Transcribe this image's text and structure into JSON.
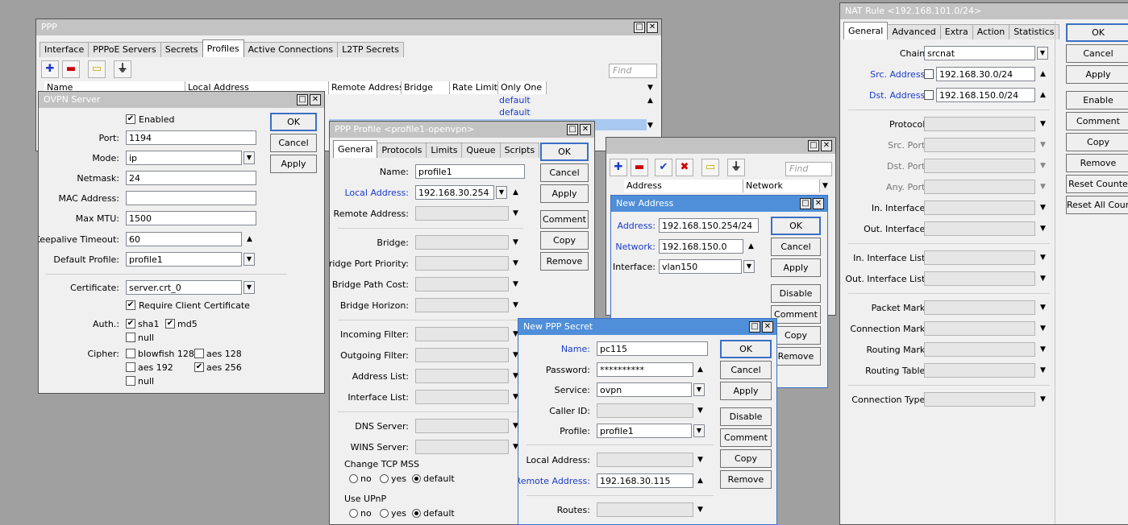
{
  "ppp": {
    "title": "PPP",
    "tabs": [
      "Interface",
      "PPPoE Servers",
      "Secrets",
      "Profiles",
      "Active Connections",
      "L2TP Secrets"
    ],
    "find": "Find",
    "cols": [
      "Name",
      "Local Address",
      "Remote Address",
      "Bridge",
      "Rate Limit...",
      "Only One"
    ],
    "rows": [
      "default",
      "default"
    ]
  },
  "ovpn": {
    "title": "OVPN Server",
    "enabled": "Enabled",
    "port_label": "Port:",
    "port": "1194",
    "mode_label": "Mode:",
    "mode": "ip",
    "netmask_label": "Netmask:",
    "netmask": "24",
    "mac_label": "MAC Address:",
    "mac": "",
    "mtu_label": "Max MTU:",
    "mtu": "1500",
    "keepalive_label": "Keepalive Timeout:",
    "keepalive": "60",
    "profile_label": "Default Profile:",
    "profile": "profile1",
    "cert_label": "Certificate:",
    "cert": "server.crt_0",
    "require": "Require Client Certificate",
    "auth_label": "Auth.:",
    "sha1": "sha1",
    "md5": "md5",
    "null1": "null",
    "cipher_label": "Cipher:",
    "blowfish": "blowfish 128",
    "aes128": "aes 128",
    "aes192": "aes 192",
    "aes256": "aes 256",
    "null2": "null",
    "ok": "OK",
    "cancel": "Cancel",
    "apply": "Apply"
  },
  "profile": {
    "title": "PPP Profile <profile1-openvpn>",
    "tabs": [
      "General",
      "Protocols",
      "Limits",
      "Queue",
      "Scripts"
    ],
    "name_label": "Name:",
    "name": "profile1",
    "local_label": "Local Address:",
    "local": "192.168.30.254",
    "remote_label": "Remote Address:",
    "bridge": "Bridge:",
    "bpp": "Bridge Port Priority:",
    "bpc": "Bridge Path Cost:",
    "bh": "Bridge Horizon:",
    "inf": "Incoming Filter:",
    "outf": "Outgoing Filter:",
    "al": "Address List:",
    "il": "Interface List:",
    "dns": "DNS Server:",
    "wins": "WINS Server:",
    "tcp": "Change TCP MSS",
    "upnp": "Use UPnP",
    "no": "no",
    "yes": "yes",
    "default": "default",
    "ok": "OK",
    "cancel": "Cancel",
    "apply": "Apply",
    "comment": "Comment",
    "copy": "Copy",
    "remove": "Remove"
  },
  "addrlist": {
    "find": "Find",
    "col_address": "Address",
    "col_network": "Network"
  },
  "newaddr": {
    "title": "New Address",
    "address_label": "Address:",
    "address": "192.168.150.254/24",
    "network_label": "Network:",
    "network": "192.168.150.0",
    "iface_label": "Interface:",
    "iface": "vlan150",
    "ok": "OK",
    "cancel": "Cancel",
    "apply": "Apply",
    "disable": "Disable",
    "comment": "Comment",
    "copy": "Copy",
    "remove": "Remove"
  },
  "secret": {
    "title": "New PPP Secret",
    "name_label": "Name:",
    "name": "pc115",
    "pw_label": "Password:",
    "pw": "**********",
    "service_label": "Service:",
    "service": "ovpn",
    "caller_label": "Caller ID:",
    "profile_label": "Profile:",
    "profile": "profile1",
    "local_label": "Local Address:",
    "remote_label": "Remote Address:",
    "remote": "192.168.30.115",
    "routes_label": "Routes:",
    "ok": "OK",
    "cancel": "Cancel",
    "apply": "Apply",
    "disable": "Disable",
    "comment": "Comment",
    "copy": "Copy",
    "remove": "Remove"
  },
  "nat": {
    "title": "NAT Rule <192.168.101.0/24>",
    "tabs": [
      "General",
      "Advanced",
      "Extra",
      "Action",
      "Statistics"
    ],
    "chain_label": "Chain:",
    "chain": "srcnat",
    "src_label": "Src. Address:",
    "src": "192.168.30.0/24",
    "dst_label": "Dst. Address:",
    "dst": "192.168.150.0/24",
    "protocol": "Protocol:",
    "srcport": "Src. Port:",
    "dstport": "Dst. Port:",
    "anyport": "Any. Port:",
    "inif": "In. Interface:",
    "outif": "Out. Interface:",
    "inifl": "In. Interface List:",
    "outifl": "Out. Interface List:",
    "pmark": "Packet Mark:",
    "cmark": "Connection Mark:",
    "rmark": "Routing Mark:",
    "rtable": "Routing Table:",
    "ctype": "Connection Type:",
    "ok": "OK",
    "cancel": "Cancel",
    "apply": "Apply",
    "enable": "Enable",
    "comment": "Comment",
    "copy": "Copy",
    "remove": "Remove",
    "reset": "Reset Counte",
    "resetall": "Reset All Coun"
  }
}
